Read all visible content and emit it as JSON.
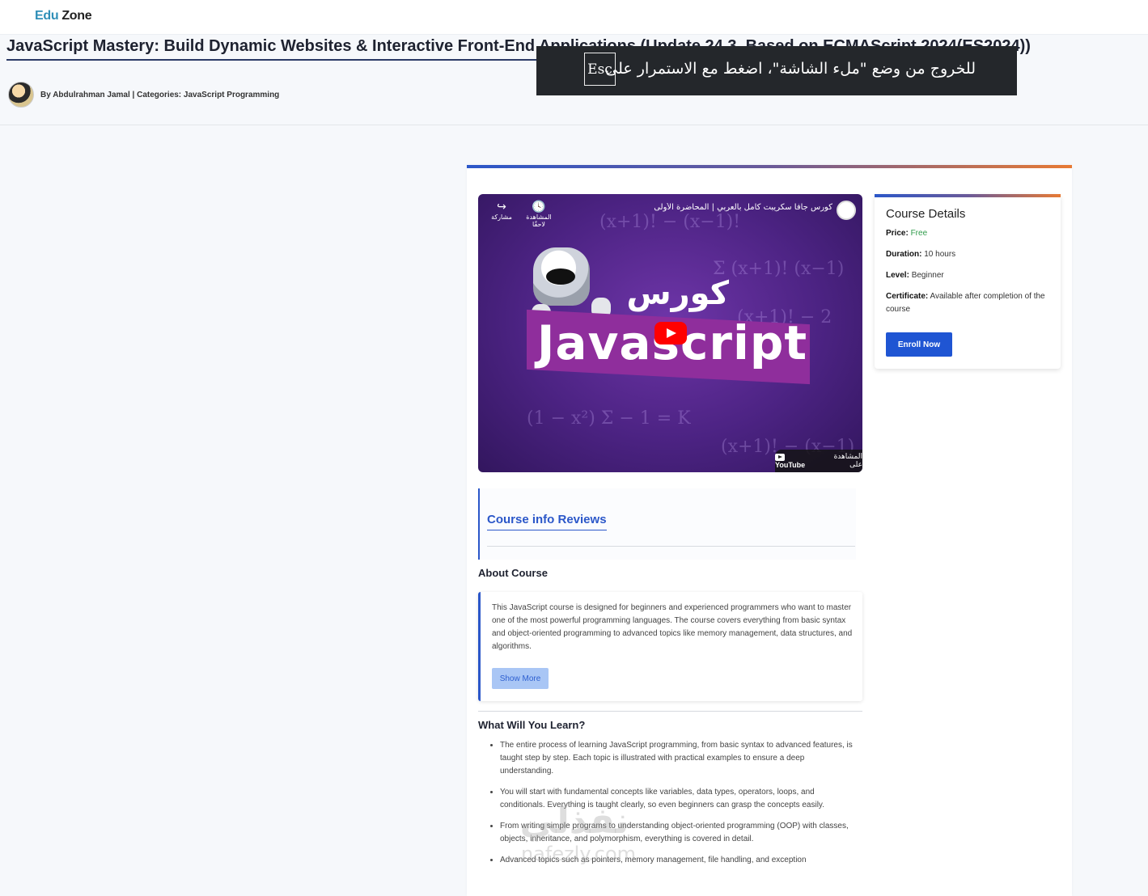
{
  "header": {
    "logo_edu": "Edu",
    "logo_zone": "Zone"
  },
  "course": {
    "title": "JavaScript Mastery: Build Dynamic Websites & Interactive Front-End Applications (Update 24.3, Based on ECMAScript 2024(ES2024))",
    "byline": "By Abdulrahman Jamal | Categories: JavaScript Programming"
  },
  "fullscreen_toast": {
    "key": "Esc",
    "text": "للخروج من وضع \"ملء الشاشة\"، اضغط مع الاستمرار على"
  },
  "video": {
    "title": "كورس جافا سكريبت كامل بالعربي | المحاضرة الأولى",
    "watch_later_label": "المشاهدة لاحقًا",
    "share_label": "مشاركة",
    "thumb_word_ar": "كورس",
    "thumb_word_en": "Javascript",
    "watch_on": "المشاهدة على",
    "youtube": "YouTube"
  },
  "details": {
    "heading": "Course Details",
    "price_label": "Price:",
    "price_value": "Free",
    "duration_label": "Duration:",
    "duration_value": "10 hours",
    "level_label": "Level:",
    "level_value": "Beginner",
    "certificate_label": "Certificate:",
    "certificate_value": "Available after completion of the course",
    "enroll_label": "Enroll Now"
  },
  "tabs": {
    "active_label": "Course info Reviews"
  },
  "about": {
    "heading": "About Course",
    "text": "This JavaScript course is designed for beginners and experienced programmers who want to master one of the most powerful programming languages. The course covers everything from basic syntax and object-oriented programming to advanced topics like memory management, data structures, and algorithms.",
    "show_more": "Show More"
  },
  "learn": {
    "heading": "What Will You Learn?",
    "items": [
      "The entire process of learning JavaScript programming, from basic syntax to advanced features, is taught step by step. Each topic is illustrated with practical examples to ensure a deep understanding.",
      "You will start with fundamental concepts like variables, data types, operators, loops, and conditionals. Everything is taught clearly, so even beginners can grasp the concepts easily.",
      "From writing simple programs to understanding object-oriented programming (OOP) with classes, objects, inheritance, and polymorphism, everything is covered in detail.",
      "Advanced topics such as pointers, memory management, file handling, and exception"
    ]
  },
  "watermark": {
    "arabic": "نفذلي",
    "latin": "nafezly.com"
  },
  "colors": {
    "brand_blue": "#2b57c9",
    "accent_orange": "#e87a33",
    "free_green": "#2e9b4a",
    "logo_teal": "#2f8fb8"
  }
}
